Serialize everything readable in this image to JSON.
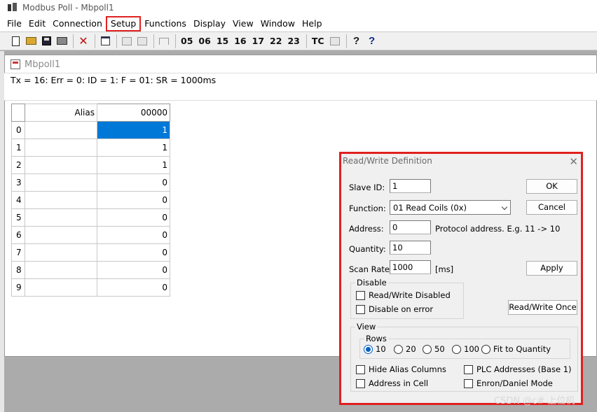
{
  "app": {
    "title": "Modbus Poll - Mbpoll1"
  },
  "menu": [
    "File",
    "Edit",
    "Connection",
    "Setup",
    "Functions",
    "Display",
    "View",
    "Window",
    "Help"
  ],
  "toolbar": {
    "function_codes": [
      "05",
      "06",
      "15",
      "16",
      "17",
      "22",
      "23"
    ],
    "tc_label": "TC"
  },
  "child": {
    "title": "Mbpoll1",
    "status": "Tx = 16: Err = 0: ID = 1: F = 01: SR = 1000ms",
    "columns": [
      "Alias",
      "00000"
    ],
    "rows": [
      {
        "index": "0",
        "alias": "",
        "value": "1"
      },
      {
        "index": "1",
        "alias": "",
        "value": "1"
      },
      {
        "index": "2",
        "alias": "",
        "value": "1"
      },
      {
        "index": "3",
        "alias": "",
        "value": "0"
      },
      {
        "index": "4",
        "alias": "",
        "value": "0"
      },
      {
        "index": "5",
        "alias": "",
        "value": "0"
      },
      {
        "index": "6",
        "alias": "",
        "value": "0"
      },
      {
        "index": "7",
        "alias": "",
        "value": "0"
      },
      {
        "index": "8",
        "alias": "",
        "value": "0"
      },
      {
        "index": "9",
        "alias": "",
        "value": "0"
      }
    ]
  },
  "dialog": {
    "title": "Read/Write Definition",
    "slave_id_label": "Slave ID:",
    "slave_id_value": "1",
    "function_label": "Function:",
    "function_value": "01 Read Coils (0x)",
    "address_label": "Address:",
    "address_value": "0",
    "address_hint": "Protocol address. E.g. 11 -> 10",
    "quantity_label": "Quantity:",
    "quantity_value": "10",
    "scan_rate_label": "Scan Rate:",
    "scan_rate_value": "1000",
    "scan_rate_unit": "[ms]",
    "ok": "OK",
    "cancel": "Cancel",
    "apply": "Apply",
    "read_write_once": "Read/Write Once",
    "disable": {
      "legend": "Disable",
      "rw_disabled": "Read/Write Disabled",
      "on_error": "Disable on error"
    },
    "view": {
      "legend": "View",
      "rows_legend": "Rows",
      "rows_options": [
        "10",
        "20",
        "50",
        "100",
        "Fit to Quantity"
      ],
      "rows_selected": "10",
      "hide_alias": "Hide Alias Columns",
      "plc_addresses": "PLC Addresses (Base 1)",
      "address_in_cell": "Address in Cell",
      "enron_daniel": "Enron/Daniel Mode"
    }
  },
  "watermark": "CSDN @c# 上位机"
}
